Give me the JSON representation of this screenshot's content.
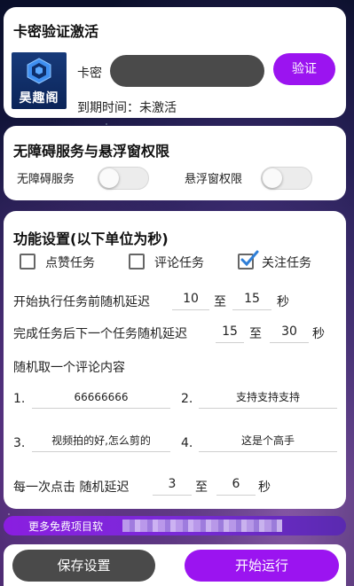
{
  "activation": {
    "title": "卡密验证激活",
    "logo_text": "昊趣阁",
    "km_label": "卡密",
    "km_value": "",
    "verify_label": "验证",
    "expire_text": "到期时间：未激活"
  },
  "permissions": {
    "title": "无障碍服务与悬浮窗权限",
    "accessibility_label": "无障碍服务",
    "accessibility_on": false,
    "overlay_label": "悬浮窗权限",
    "overlay_on": false
  },
  "settings": {
    "title": "功能设置(以下单位为秒)",
    "tasks": [
      {
        "label": "点赞任务",
        "checked": false
      },
      {
        "label": "评论任务",
        "checked": false
      },
      {
        "label": "关注任务",
        "checked": true
      }
    ],
    "delay_before": {
      "label": "开始执行任务前随机延迟",
      "min": "10",
      "to": "至",
      "max": "15",
      "unit": "秒"
    },
    "delay_next": {
      "label": "完成任务后下一个任务随机延迟",
      "min": "15",
      "to": "至",
      "max": "30",
      "unit": "秒"
    },
    "comment_label": "随机取一个评论内容",
    "comments": [
      {
        "index": "1.",
        "value": "66666666"
      },
      {
        "index": "2.",
        "value": "支持支持支持"
      },
      {
        "index": "3.",
        "value": "视频拍的好,怎么剪的"
      },
      {
        "index": "4.",
        "value": "这是个高手"
      }
    ],
    "click_delay": {
      "label": "每一次点击 随机延迟",
      "min": "3",
      "to": "至",
      "max": "6",
      "unit": "秒"
    }
  },
  "banner": {
    "text": "更多免费项目软"
  },
  "actions": {
    "save_label": "保存设置",
    "start_label": "开始运行"
  },
  "colors": {
    "accent": "#9b14f0",
    "dark_button": "#4a4a4a"
  }
}
